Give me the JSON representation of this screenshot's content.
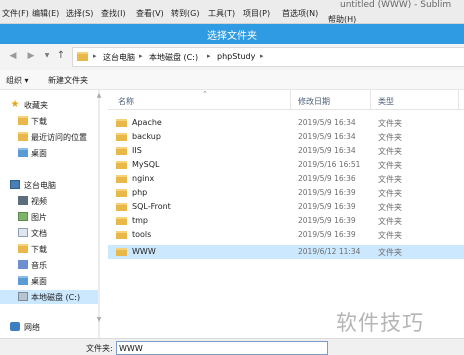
{
  "sublime": {
    "menu": [
      "文件(F)",
      "编辑(E)",
      "选择(S)",
      "查找(I)",
      "查看(V)",
      "转到(G)",
      "工具(T)",
      "项目(P)",
      "首选项(N)",
      "帮助(H)"
    ],
    "window_title": "untitled (WWW) - Sublim"
  },
  "dialog": {
    "title": "选择文件夹"
  },
  "address": {
    "segments": [
      "这台电脑",
      "本地磁盘 (C:)",
      "phpStudy"
    ]
  },
  "toolbar": {
    "organize": "组织 ▾",
    "new_folder": "新建文件夹"
  },
  "nav": {
    "items": [
      {
        "label": "收藏夹",
        "icon": "star-icon"
      },
      {
        "label": "下载",
        "icon": "folder-icon"
      },
      {
        "label": "最近访问的位置",
        "icon": "folder-icon"
      },
      {
        "label": "桌面",
        "icon": "folder-icon"
      },
      {
        "label": "这台电脑",
        "icon": "pc-icon"
      },
      {
        "label": "视频",
        "icon": "video-icon"
      },
      {
        "label": "图片",
        "icon": "image-icon"
      },
      {
        "label": "文档",
        "icon": "document-icon"
      },
      {
        "label": "下载",
        "icon": "folder-icon"
      },
      {
        "label": "音乐",
        "icon": "music-icon"
      },
      {
        "label": "桌面",
        "icon": "folder-icon"
      },
      {
        "label": "本地磁盘 (C:)",
        "icon": "drive-icon"
      },
      {
        "label": "网络",
        "icon": "network-icon"
      }
    ]
  },
  "columns": {
    "name": "名称",
    "date": "修改日期",
    "type": "类型"
  },
  "files": [
    {
      "name": "Apache",
      "date": "2019/5/9 16:34",
      "type": "文件夹"
    },
    {
      "name": "backup",
      "date": "2019/5/9 16:34",
      "type": "文件夹"
    },
    {
      "name": "IIS",
      "date": "2019/5/9 16:34",
      "type": "文件夹"
    },
    {
      "name": "MySQL",
      "date": "2019/5/16 16:51",
      "type": "文件夹"
    },
    {
      "name": "nginx",
      "date": "2019/5/9 16:36",
      "type": "文件夹"
    },
    {
      "name": "php",
      "date": "2019/5/9 16:39",
      "type": "文件夹"
    },
    {
      "name": "SQL-Front",
      "date": "2019/5/9 16:39",
      "type": "文件夹"
    },
    {
      "name": "tmp",
      "date": "2019/5/9 16:39",
      "type": "文件夹"
    },
    {
      "name": "tools",
      "date": "2019/5/9 16:39",
      "type": "文件夹"
    },
    {
      "name": "WWW",
      "date": "2019/6/12 11:34",
      "type": "文件夹"
    }
  ],
  "filename": {
    "label": "文件夹:",
    "value": "WWW"
  },
  "watermark": "软件技巧",
  "colors": {
    "title_bar": "#2f9be2",
    "selection": "#cce8ff",
    "folder": "#e8b84a"
  }
}
